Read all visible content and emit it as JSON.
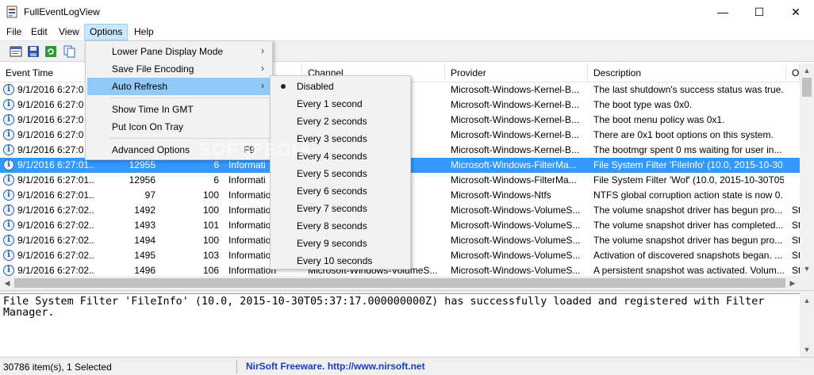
{
  "window": {
    "title": "FullEventLogView",
    "minimize": "—",
    "maximize": "☐",
    "close": "✕"
  },
  "menubar": [
    "File",
    "Edit",
    "View",
    "Options",
    "Help"
  ],
  "toolbar_icons": [
    "properties-icon",
    "save-icon",
    "refresh-icon",
    "copy-icon"
  ],
  "columns": [
    "Event Time",
    "Channel",
    "Provider",
    "Description",
    "O"
  ],
  "rows": [
    {
      "time": "9/1/2016 6:27:0",
      "provider": "Microsoft-Windows-Kernel-B...",
      "description": "The last shutdown's success status was true...."
    },
    {
      "time": "9/1/2016 6:27:0",
      "provider": "Microsoft-Windows-Kernel-B...",
      "description": "The boot type was 0x0."
    },
    {
      "time": "9/1/2016 6:27:0",
      "provider": "Microsoft-Windows-Kernel-B...",
      "description": "The boot menu policy was 0x1."
    },
    {
      "time": "9/1/2016 6:27:0",
      "provider": "Microsoft-Windows-Kernel-B...",
      "description": "There are 0x1 boot options on this system."
    },
    {
      "time": "9/1/2016 6:27:0",
      "provider": "Microsoft-Windows-Kernel-B...",
      "description": "The bootmgr spent 0 ms waiting for user in..."
    },
    {
      "time": "9/1/2016 6:27:01...",
      "record": "12955",
      "id": "6",
      "level": "Informati",
      "provider": "Microsoft-Windows-FilterMa...",
      "description": "File System Filter 'FileInfo' (10.0, 2015-10-30...",
      "selected": true
    },
    {
      "time": "9/1/2016 6:27:01...",
      "record": "12956",
      "id": "6",
      "level": "Informati",
      "provider": "Microsoft-Windows-FilterMa...",
      "description": "File System Filter 'Wof' (10.0, 2015-10-30T05:..."
    },
    {
      "time": "9/1/2016 6:27:01...",
      "record": "97",
      "id": "100",
      "level": "Information",
      "channel": "s/WHC",
      "provider": "Microsoft-Windows-Ntfs",
      "description": "NTFS global corruption action state is now 0."
    },
    {
      "time": "9/1/2016 6:27:02...",
      "record": "1492",
      "id": "100",
      "level": "Information",
      "channel": "umeS...",
      "provider": "Microsoft-Windows-VolumeS...",
      "description": "The volume snapshot driver has begun pro...",
      "extra": "St"
    },
    {
      "time": "9/1/2016 6:27:02...",
      "record": "1493",
      "id": "101",
      "level": "Information",
      "channel": "umeS...",
      "provider": "Microsoft-Windows-VolumeS...",
      "description": "The volume snapshot driver has completed...",
      "extra": "St"
    },
    {
      "time": "9/1/2016 6:27:02...",
      "record": "1494",
      "id": "100",
      "level": "Information",
      "channel": "umeS...",
      "provider": "Microsoft-Windows-VolumeS...",
      "description": "The volume snapshot driver has begun pro...",
      "extra": "St"
    },
    {
      "time": "9/1/2016 6:27:02...",
      "record": "1495",
      "id": "103",
      "level": "Information",
      "channel": "umeS...",
      "provider": "Microsoft-Windows-VolumeS...",
      "description": "Activation of discovered snapshots began. ...",
      "extra": "St"
    },
    {
      "time": "9/1/2016 6:27:02...",
      "record": "1496",
      "id": "106",
      "level": "Information",
      "channel": "Microsoft-Windows-VolumeS...",
      "provider": "Microsoft-Windows-VolumeS...",
      "description": "A persistent snapshot was activated. Volum...",
      "extra": "St"
    }
  ],
  "options_menu": {
    "items": [
      {
        "label": "Lower Pane Display Mode",
        "submenu": true
      },
      {
        "label": "Save File Encoding",
        "submenu": true
      },
      {
        "label": "Auto Refresh",
        "submenu": true,
        "highlighted": true
      },
      {
        "label": "Show Time In GMT"
      },
      {
        "label": "Put Icon On Tray"
      },
      {
        "label": "Advanced Options",
        "shortcut": "F9"
      }
    ]
  },
  "auto_refresh_menu": {
    "selected": "Disabled",
    "items": [
      "Disabled",
      "Every 1 second",
      "Every 2 seconds",
      "Every 3 seconds",
      "Every 4 seconds",
      "Every 5 seconds",
      "Every 6 seconds",
      "Every 7 seconds",
      "Every 8 seconds",
      "Every 9 seconds",
      "Every 10 seconds"
    ]
  },
  "lower_pane": {
    "text": "File System Filter 'FileInfo' (10.0, 2015-10-30T05:37:17.000000000Z) has successfully loaded and registered with Filter Manager."
  },
  "watermark": "SOFTPEDIA",
  "status": {
    "count": "30786 item(s), 1 Selected",
    "link": "NirSoft Freeware.  http://www.nirsoft.net"
  }
}
